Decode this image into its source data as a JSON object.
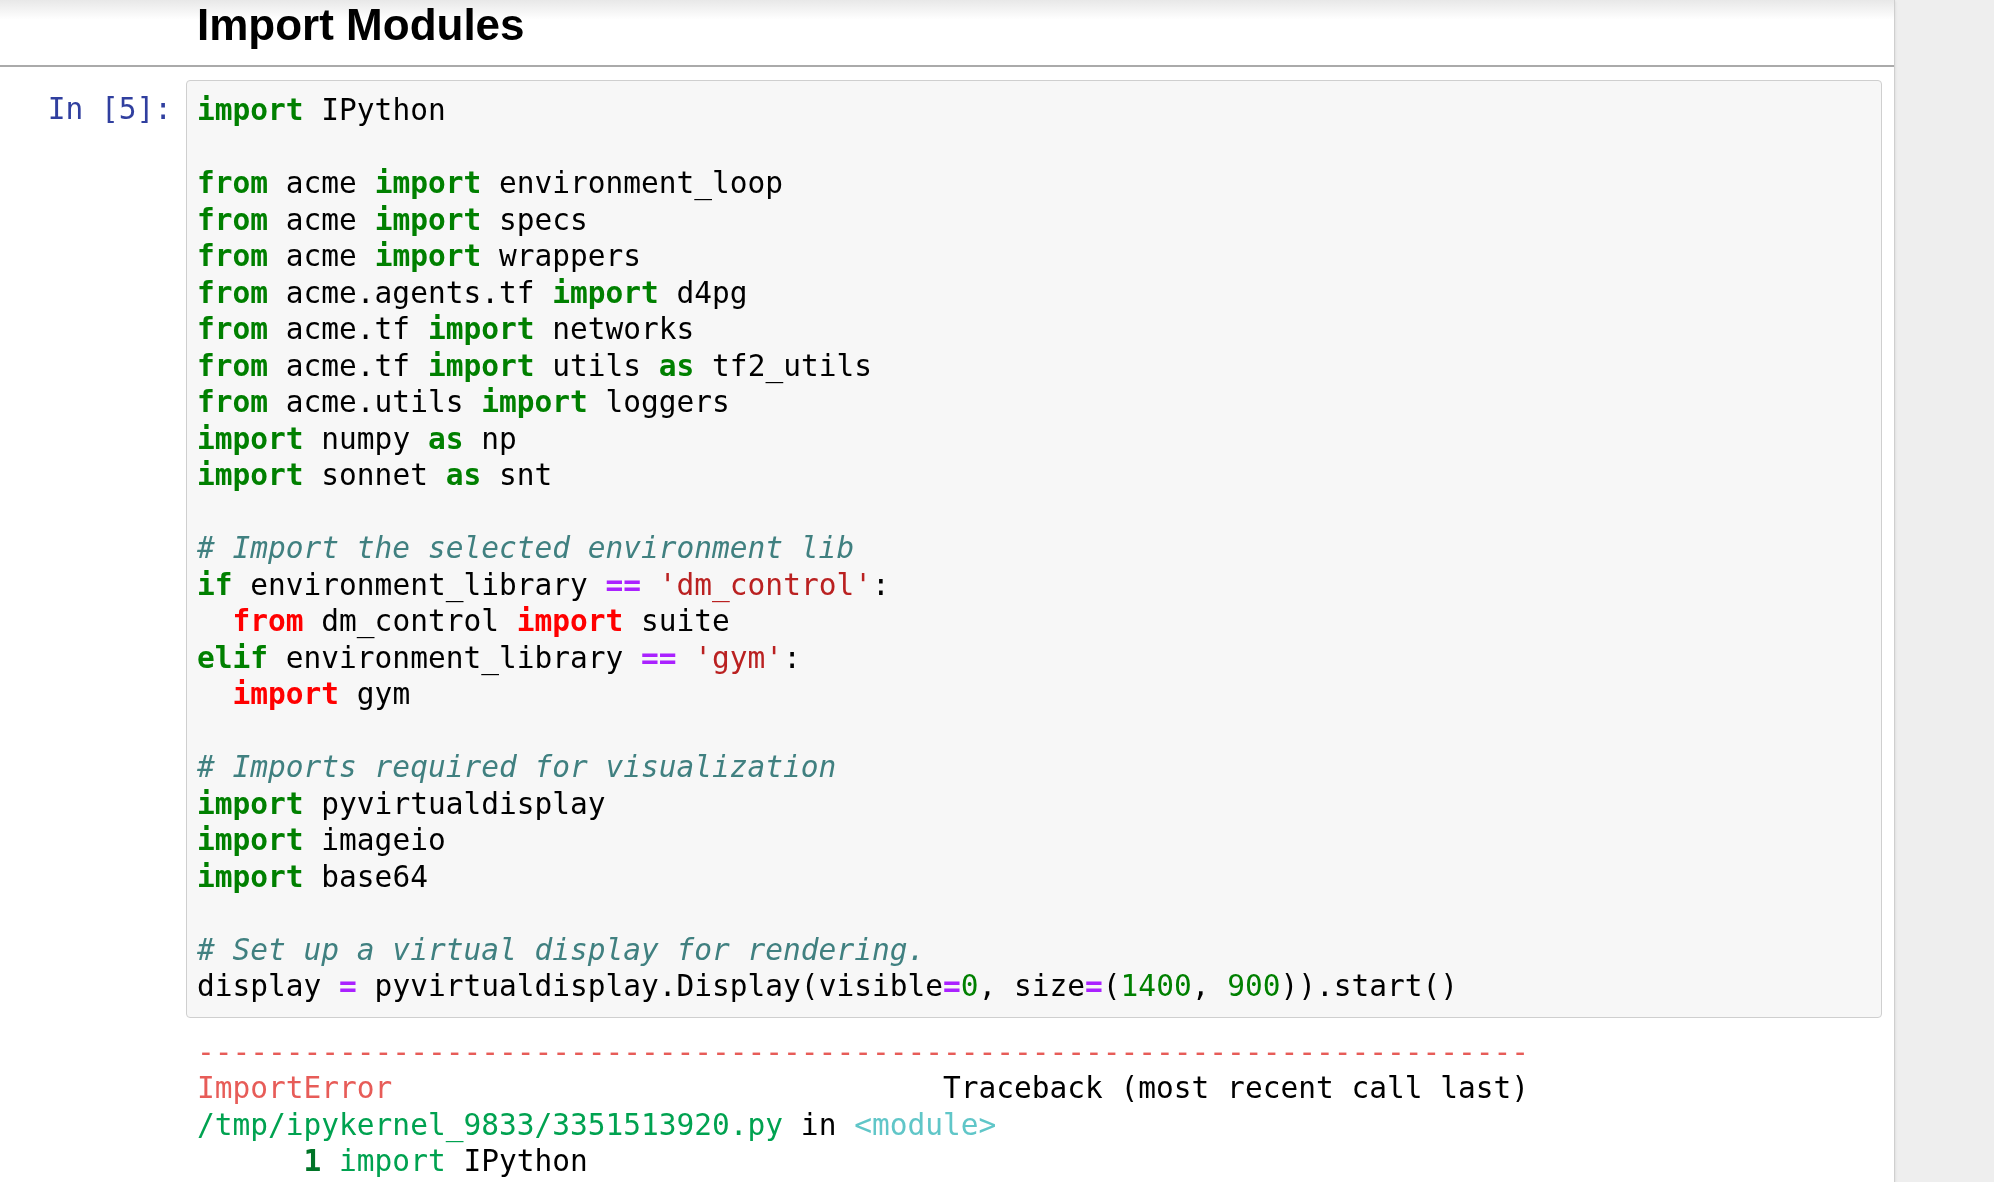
{
  "heading": "Import Modules",
  "cell": {
    "prompt": "In [5]:",
    "blocks": [
      [
        {
          "tokens": [
            {
              "text": "import",
              "kind": "kw"
            },
            {
              "text": " IPython",
              "kind": "plain"
            }
          ]
        }
      ],
      [
        {
          "tokens": [
            {
              "text": "from",
              "kind": "kw"
            },
            {
              "text": " acme ",
              "kind": "plain"
            },
            {
              "text": "import",
              "kind": "kw"
            },
            {
              "text": " environment_loop",
              "kind": "plain"
            }
          ]
        },
        {
          "tokens": [
            {
              "text": "from",
              "kind": "kw"
            },
            {
              "text": " acme ",
              "kind": "plain"
            },
            {
              "text": "import",
              "kind": "kw"
            },
            {
              "text": " specs",
              "kind": "plain"
            }
          ]
        },
        {
          "tokens": [
            {
              "text": "from",
              "kind": "kw"
            },
            {
              "text": " acme ",
              "kind": "plain"
            },
            {
              "text": "import",
              "kind": "kw"
            },
            {
              "text": " wrappers",
              "kind": "plain"
            }
          ]
        },
        {
          "tokens": [
            {
              "text": "from",
              "kind": "kw"
            },
            {
              "text": " acme.agents.tf ",
              "kind": "plain"
            },
            {
              "text": "import",
              "kind": "kw"
            },
            {
              "text": " d4pg",
              "kind": "plain"
            }
          ]
        },
        {
          "tokens": [
            {
              "text": "from",
              "kind": "kw"
            },
            {
              "text": " acme.tf ",
              "kind": "plain"
            },
            {
              "text": "import",
              "kind": "kw"
            },
            {
              "text": " networks",
              "kind": "plain"
            }
          ]
        },
        {
          "tokens": [
            {
              "text": "from",
              "kind": "kw"
            },
            {
              "text": " acme.tf ",
              "kind": "plain"
            },
            {
              "text": "import",
              "kind": "kw"
            },
            {
              "text": " utils ",
              "kind": "plain"
            },
            {
              "text": "as",
              "kind": "kw"
            },
            {
              "text": " tf2_utils",
              "kind": "plain"
            }
          ]
        },
        {
          "tokens": [
            {
              "text": "from",
              "kind": "kw"
            },
            {
              "text": " acme.utils ",
              "kind": "plain"
            },
            {
              "text": "import",
              "kind": "kw"
            },
            {
              "text": " loggers",
              "kind": "plain"
            }
          ]
        },
        {
          "tokens": [
            {
              "text": "import",
              "kind": "kw"
            },
            {
              "text": " numpy ",
              "kind": "plain"
            },
            {
              "text": "as",
              "kind": "kw"
            },
            {
              "text": " np",
              "kind": "plain"
            }
          ]
        },
        {
          "tokens": [
            {
              "text": "import",
              "kind": "kw"
            },
            {
              "text": " sonnet ",
              "kind": "plain"
            },
            {
              "text": "as",
              "kind": "kw"
            },
            {
              "text": " snt",
              "kind": "plain"
            }
          ]
        }
      ],
      [
        {
          "tokens": [
            {
              "text": "# Import the selected environment lib",
              "kind": "comment"
            }
          ]
        },
        {
          "tokens": [
            {
              "text": "if",
              "kind": "kw"
            },
            {
              "text": " environment_library ",
              "kind": "plain"
            },
            {
              "text": "==",
              "kind": "op"
            },
            {
              "text": " 'dm_control'",
              "kind": "str"
            },
            {
              "text": ":",
              "kind": "plain"
            }
          ]
        },
        {
          "tokens": [
            {
              "text": "  from",
              "kind": "errkw"
            },
            {
              "text": " dm_control ",
              "kind": "plain"
            },
            {
              "text": "import",
              "kind": "errkw"
            },
            {
              "text": " suite",
              "kind": "plain"
            }
          ]
        },
        {
          "tokens": [
            {
              "text": "elif",
              "kind": "kw"
            },
            {
              "text": " environment_library ",
              "kind": "plain"
            },
            {
              "text": "==",
              "kind": "op"
            },
            {
              "text": " 'gym'",
              "kind": "str"
            },
            {
              "text": ":",
              "kind": "plain"
            }
          ]
        },
        {
          "tokens": [
            {
              "text": "  import",
              "kind": "errkw"
            },
            {
              "text": " gym",
              "kind": "plain"
            }
          ]
        }
      ],
      [
        {
          "tokens": [
            {
              "text": "# Imports required for visualization",
              "kind": "comment"
            }
          ]
        },
        {
          "tokens": [
            {
              "text": "import",
              "kind": "kw"
            },
            {
              "text": " pyvirtualdisplay",
              "kind": "plain"
            }
          ]
        },
        {
          "tokens": [
            {
              "text": "import",
              "kind": "kw"
            },
            {
              "text": " imageio",
              "kind": "plain"
            }
          ]
        },
        {
          "tokens": [
            {
              "text": "import",
              "kind": "kw"
            },
            {
              "text": " base64",
              "kind": "plain"
            }
          ]
        }
      ],
      [
        {
          "tokens": [
            {
              "text": "# Set up a virtual display for rendering.",
              "kind": "comment"
            }
          ]
        },
        {
          "tokens": [
            {
              "text": "display ",
              "kind": "plain"
            },
            {
              "text": "=",
              "kind": "op"
            },
            {
              "text": " pyvirtualdisplay.Display(visible",
              "kind": "plain"
            },
            {
              "text": "=",
              "kind": "op"
            },
            {
              "text": "0",
              "kind": "num"
            },
            {
              "text": ", size",
              "kind": "plain"
            },
            {
              "text": "=",
              "kind": "op"
            },
            {
              "text": "(",
              "kind": "plain"
            },
            {
              "text": "1400",
              "kind": "num"
            },
            {
              "text": ", ",
              "kind": "plain"
            },
            {
              "text": "900",
              "kind": "num"
            },
            {
              "text": ")).start()",
              "kind": "plain"
            }
          ]
        }
      ]
    ],
    "output": [
      {
        "tokens": [
          {
            "text": "---------------------------------------------------------------------------",
            "kind": "ename"
          }
        ]
      },
      {
        "tokens": [
          {
            "text": "ImportError",
            "kind": "ename"
          },
          {
            "text": "                               Traceback (most recent call last)",
            "kind": "plain"
          }
        ]
      },
      {
        "tokens": [
          {
            "text": "/tmp/ipykernel_9833/3351513920.py",
            "kind": "path"
          },
          {
            "text": " in ",
            "kind": "plain"
          },
          {
            "text": "<module>",
            "kind": "module"
          }
        ]
      },
      {
        "tokens": [
          {
            "text": "      1",
            "kind": "lineno"
          },
          {
            "text": " import",
            "kind": "path"
          },
          {
            "text": " IPython",
            "kind": "plain"
          }
        ]
      }
    ]
  }
}
